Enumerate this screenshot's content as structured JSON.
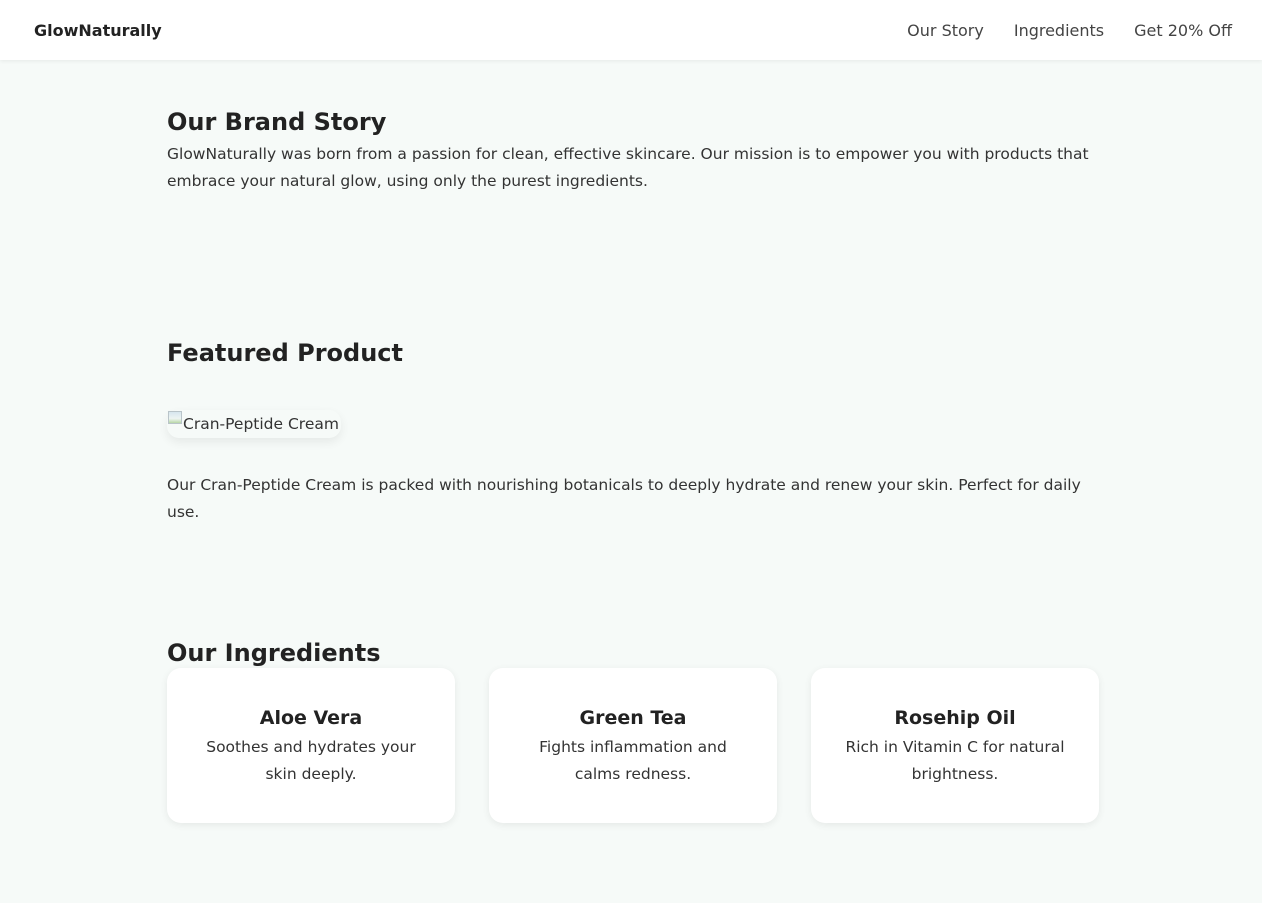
{
  "header": {
    "logo": "GlowNaturally",
    "nav": [
      "Our Story",
      "Ingredients",
      "Get 20% Off"
    ]
  },
  "story": {
    "heading": "Our Brand Story",
    "text": "GlowNaturally was born from a passion for clean, effective skincare. Our mission is to empower you with products that embrace your natural glow, using only the purest ingredients."
  },
  "featured": {
    "heading": "Featured Product",
    "image_alt": "Cran-Peptide Cream",
    "text": "Our Cran-Peptide Cream is packed with nourishing botanicals to deeply hydrate and renew your skin. Perfect for daily use."
  },
  "ingredients": {
    "heading": "Our Ingredients",
    "items": [
      {
        "name": "Aloe Vera",
        "desc": "Soothes and hydrates your skin deeply."
      },
      {
        "name": "Green Tea",
        "desc": "Fights inflammation and calms redness."
      },
      {
        "name": "Rosehip Oil",
        "desc": "Rich in Vitamin C for natural brightness."
      }
    ]
  },
  "colors": {
    "page_bg": "#f6faf8",
    "header_bg": "#ffffff",
    "card_bg": "#ffffff",
    "text": "#2b2b2b"
  }
}
